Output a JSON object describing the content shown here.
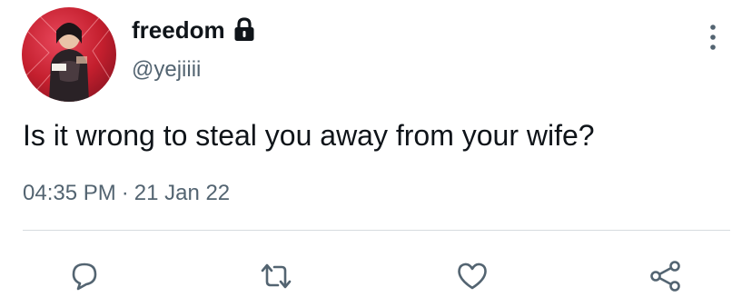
{
  "tweet": {
    "author": {
      "display_name": "freedom",
      "handle": "@yejiiii",
      "protected_icon": "lock-icon",
      "avatar_icon": "profile-photo"
    },
    "text": "Is it wrong to steal you away from your wife?",
    "time": "04:35 PM",
    "separator": "·",
    "date": "21 Jan 22"
  },
  "actions": [
    {
      "name": "reply",
      "icon": "comment-icon"
    },
    {
      "name": "retweet",
      "icon": "retweet-icon"
    },
    {
      "name": "like",
      "icon": "heart-icon"
    },
    {
      "name": "share",
      "icon": "share-icon"
    }
  ],
  "menu_icon": "more-vertical-icon",
  "colors": {
    "text": "#0f1419",
    "secondary": "#536471",
    "divider": "#d6dbdf",
    "icon": "#536471"
  }
}
